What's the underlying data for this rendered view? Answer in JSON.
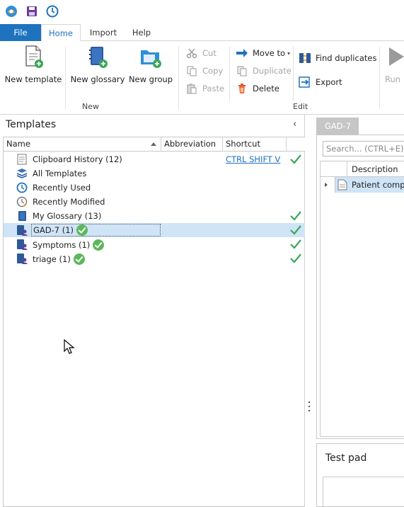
{
  "quick_access": {
    "icons": [
      "app-logo-icon",
      "save-icon",
      "clock-icon"
    ]
  },
  "ribbon_tabs": {
    "file": "File",
    "home": "Home",
    "import": "Import",
    "help": "Help"
  },
  "ribbon": {
    "new_group": {
      "label": "New",
      "new_template": "New template",
      "new_glossary": "New glossary",
      "new_group": "New group"
    },
    "edit_group": {
      "label": "Edit",
      "cut": "Cut",
      "copy": "Copy",
      "paste": "Paste",
      "move_to": "Move to",
      "duplicate": "Duplicate",
      "delete": "Delete",
      "find_duplicates": "Find duplicates",
      "export": "Export"
    },
    "run_label": "Run"
  },
  "templates_pane": {
    "title": "Templates",
    "columns": {
      "name": "Name",
      "abbreviation": "Abbreviation",
      "shortcut": "Shortcut"
    },
    "rows": [
      {
        "name": "Clipboard History (12)",
        "icon": "clipboard-icon",
        "shortcut": "CTRL SHIFT V",
        "checked": true
      },
      {
        "name": "All Templates",
        "icon": "stack-icon",
        "shortcut": "",
        "checked": false
      },
      {
        "name": "Recently Used",
        "icon": "clock-icon",
        "shortcut": "",
        "checked": false
      },
      {
        "name": "Recently Modified",
        "icon": "clock-edit-icon",
        "shortcut": "",
        "checked": false
      },
      {
        "name": "My Glossary (13)",
        "icon": "glossary-icon",
        "shortcut": "",
        "checked": true
      },
      {
        "name": "GAD-7 (1)",
        "icon": "shared-glossary-icon",
        "shortcut": "",
        "checked": true,
        "selected": true,
        "badge": true
      },
      {
        "name": "Symptoms (1)",
        "icon": "shared-glossary-icon",
        "shortcut": "",
        "checked": true,
        "badge": true
      },
      {
        "name": "triage (1)",
        "icon": "shared-glossary-icon",
        "shortcut": "",
        "checked": true,
        "badge": true
      }
    ]
  },
  "detail_pane": {
    "tab": "GAD-7",
    "search_placeholder": "Search... (CTRL+E)",
    "column_description": "Description",
    "rows": [
      {
        "description": "Patient compla"
      }
    ],
    "test_pad_title": "Test pad"
  },
  "colors": {
    "accent": "#1e73be",
    "selection": "#cfe4f7",
    "check_green": "#5cb85c"
  }
}
